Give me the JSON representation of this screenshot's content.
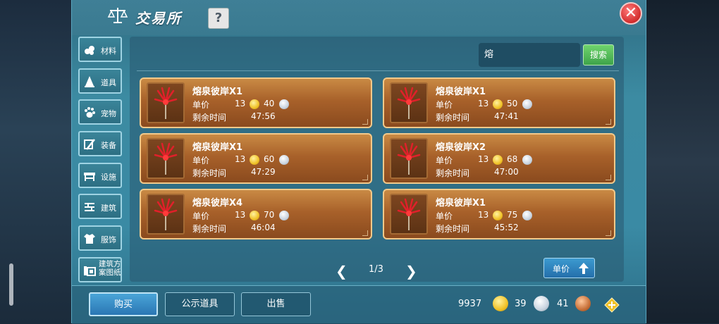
{
  "window": {
    "title": "交易所",
    "help_label": "?",
    "close_label": "✕"
  },
  "sidebar": {
    "items": [
      {
        "label": "材料",
        "icon": "materials-icon"
      },
      {
        "label": "道具",
        "icon": "item-icon"
      },
      {
        "label": "宠物",
        "icon": "pet-paw-icon"
      },
      {
        "label": "装备",
        "icon": "equipment-icon"
      },
      {
        "label": "设施",
        "icon": "facility-icon"
      },
      {
        "label": "建筑",
        "icon": "building-icon"
      },
      {
        "label": "服饰",
        "icon": "clothing-icon"
      },
      {
        "label": "建筑方案图纸",
        "icon": "blueprint-icon"
      }
    ]
  },
  "search": {
    "value": "熔",
    "button_label": "搜索"
  },
  "listings": [
    {
      "name": "熔泉彼岸X1",
      "price_label": "单价",
      "price_gold": "13",
      "price_silver": "40",
      "time_label": "剩余时间",
      "time_left": "47:56"
    },
    {
      "name": "熔泉彼岸X1",
      "price_label": "单价",
      "price_gold": "13",
      "price_silver": "50",
      "time_label": "剩余时间",
      "time_left": "47:41"
    },
    {
      "name": "熔泉彼岸X1",
      "price_label": "单价",
      "price_gold": "13",
      "price_silver": "60",
      "time_label": "剩余时间",
      "time_left": "47:29"
    },
    {
      "name": "熔泉彼岸X2",
      "price_label": "单价",
      "price_gold": "13",
      "price_silver": "68",
      "time_label": "剩余时间",
      "time_left": "47:00"
    },
    {
      "name": "熔泉彼岸X4",
      "price_label": "单价",
      "price_gold": "13",
      "price_silver": "70",
      "time_label": "剩余时间",
      "time_left": "46:04"
    },
    {
      "name": "熔泉彼岸X1",
      "price_label": "单价",
      "price_gold": "13",
      "price_silver": "75",
      "time_label": "剩余时间",
      "time_left": "45:52"
    }
  ],
  "pager": {
    "text": "1/3",
    "prev": "❮",
    "next": "❯"
  },
  "sort": {
    "label": "单价"
  },
  "tabs": {
    "buy": "购买",
    "public": "公示道具",
    "sell": "出售"
  },
  "currency": {
    "gold": "9937",
    "silver": "39",
    "copper": "41"
  },
  "colors": {
    "gold": "#f0c228",
    "silver": "#c9d4e0",
    "copper": "#c8713a",
    "close": "#d22c2c",
    "search_button": "#3ea44a"
  }
}
